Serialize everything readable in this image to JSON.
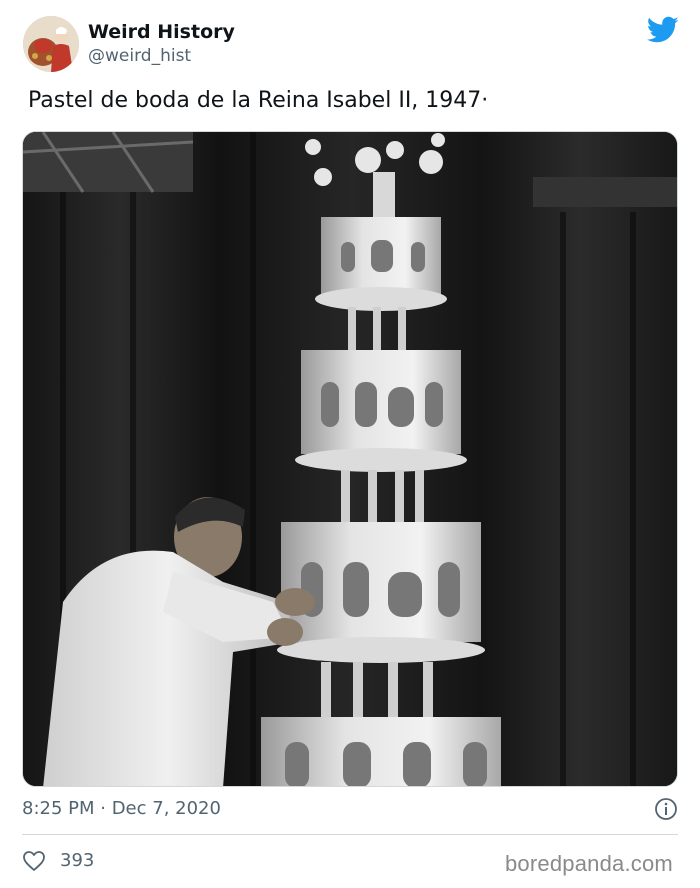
{
  "author": {
    "name": "Weird History",
    "handle": "@weird_hist",
    "avatar_icon": "vintage-portrait-avatar"
  },
  "brand_icon": "twitter-bird-icon",
  "colors": {
    "twitter_blue": "#1d9bf0",
    "text_primary": "#0f1419",
    "text_secondary": "#536471",
    "divider": "#cfd9de",
    "watermark": "#8a8a8a"
  },
  "tweet": {
    "text": "Pastel de boda de la Reina Isabel II, 1947·",
    "timestamp": "8:25 PM · Dec 7, 2020",
    "likes": "393"
  },
  "media": {
    "type": "photo",
    "style": "black-and-white"
  },
  "watermark": "boredpanda.com"
}
